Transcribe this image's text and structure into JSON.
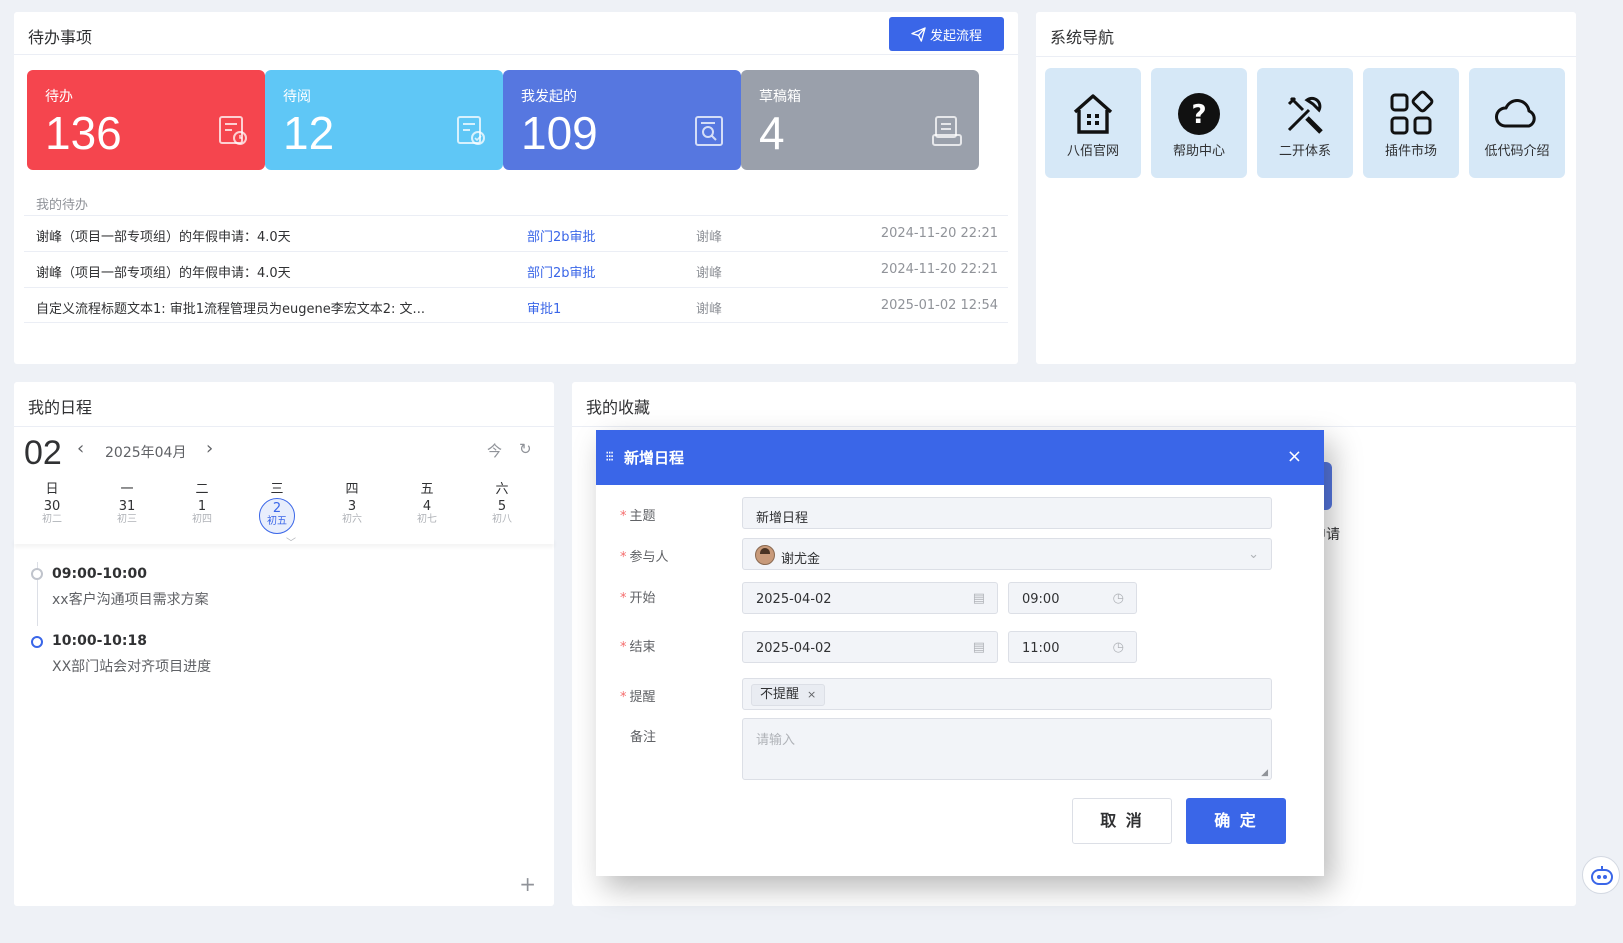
{
  "todo": {
    "title": "待办事项",
    "start_button": "发起流程",
    "stats": [
      {
        "label": "待办",
        "value": "136",
        "color": "#f5454e"
      },
      {
        "label": "待阅",
        "value": "12",
        "color": "#5fc7f6"
      },
      {
        "label": "我发起的",
        "value": "109",
        "color": "#5677e0"
      },
      {
        "label": "草稿箱",
        "value": "4",
        "color": "#9aa0ab"
      }
    ],
    "my_todo_title": "我的待办",
    "rows": [
      {
        "title": "谢峰（项目一部专项组）的年假申请：4.0天",
        "node": "部门2b审批",
        "user": "谢峰",
        "date": "2024-11-20 22:21"
      },
      {
        "title": "谢峰（项目一部专项组）的年假申请：4.0天",
        "node": "部门2b审批",
        "user": "谢峰",
        "date": "2024-11-20 22:21"
      },
      {
        "title": "自定义流程标题文本1:  审批1流程管理员为eugene李宏文本2:  文...",
        "node": "审批1",
        "user": "谢峰",
        "date": "2025-01-02 12:54"
      }
    ]
  },
  "nav": {
    "title": "系统导航",
    "items": [
      {
        "label": "八佰官网",
        "icon": "house-icon"
      },
      {
        "label": "帮助中心",
        "icon": "help-icon"
      },
      {
        "label": "二开体系",
        "icon": "tools-icon"
      },
      {
        "label": "插件市场",
        "icon": "plugin-icon"
      },
      {
        "label": "低代码介绍",
        "icon": "cloud-icon"
      }
    ]
  },
  "schedule": {
    "title": "我的日程",
    "day": "02",
    "month": "2025年04月",
    "weekdays": [
      "日",
      "一",
      "二",
      "三",
      "四",
      "五",
      "六"
    ],
    "dates": [
      {
        "g": "30",
        "l": "初二"
      },
      {
        "g": "31",
        "l": "初三"
      },
      {
        "g": "1",
        "l": "初四"
      },
      {
        "g": "2",
        "l": "初五"
      },
      {
        "g": "3",
        "l": "初六"
      },
      {
        "g": "4",
        "l": "初七"
      },
      {
        "g": "5",
        "l": "初八"
      }
    ],
    "events": [
      {
        "time": "09:00-10:00",
        "desc": "xx客户沟通项目需求方案"
      },
      {
        "time": "10:00-10:18",
        "desc": "XX部门站会对齐项目进度"
      }
    ],
    "add_symbol": "+"
  },
  "favorites": {
    "title": "我的收藏",
    "peek_text": "申请"
  },
  "modal": {
    "title": "新增日程",
    "close": "×",
    "subject_label": "主题",
    "subject_value": "新增日程",
    "participants_label": "参与人",
    "participant_name": "谢尤金",
    "start_label": "开始",
    "start_date": "2025-04-02",
    "start_time": "09:00",
    "end_label": "结束",
    "end_date": "2025-04-02",
    "end_time": "11:00",
    "remind_label": "提醒",
    "remind_value": "不提醒",
    "note_label": "备注",
    "note_placeholder": "请输入",
    "cancel": "取 消",
    "ok": "确 定"
  }
}
